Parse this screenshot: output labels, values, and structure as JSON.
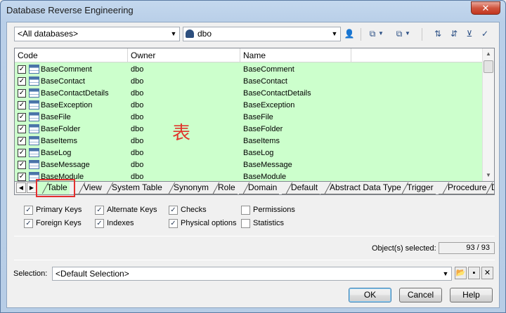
{
  "window": {
    "title": "Database Reverse Engineering",
    "close_label": "✕"
  },
  "toolbar": {
    "database_combo": "<All databases>",
    "owner_combo": "dbo"
  },
  "grid": {
    "columns": [
      "Code",
      "Owner",
      "Name"
    ],
    "rows": [
      {
        "code": "BaseComment",
        "owner": "dbo",
        "name": "BaseComment"
      },
      {
        "code": "BaseContact",
        "owner": "dbo",
        "name": "BaseContact"
      },
      {
        "code": "BaseContactDetails",
        "owner": "dbo",
        "name": "BaseContactDetails"
      },
      {
        "code": "BaseException",
        "owner": "dbo",
        "name": "BaseException"
      },
      {
        "code": "BaseFile",
        "owner": "dbo",
        "name": "BaseFile"
      },
      {
        "code": "BaseFolder",
        "owner": "dbo",
        "name": "BaseFolder"
      },
      {
        "code": "BaseItems",
        "owner": "dbo",
        "name": "BaseItems"
      },
      {
        "code": "BaseLog",
        "owner": "dbo",
        "name": "BaseLog"
      },
      {
        "code": "BaseMessage",
        "owner": "dbo",
        "name": "BaseMessage"
      },
      {
        "code": "BaseModule",
        "owner": "dbo",
        "name": "BaseModule"
      }
    ],
    "annotation": "表"
  },
  "tabs": [
    "Table",
    "View",
    "System Table",
    "Synonym",
    "Role",
    "Domain",
    "Default",
    "Abstract Data Type",
    "Trigger",
    "Procedure",
    "D"
  ],
  "active_tab": "Table",
  "options": [
    {
      "label": "Primary Keys",
      "checked": true
    },
    {
      "label": "Alternate Keys",
      "checked": true
    },
    {
      "label": "Checks",
      "checked": true
    },
    {
      "label": "Permissions",
      "checked": false
    },
    {
      "label": "Foreign Keys",
      "checked": true
    },
    {
      "label": "Indexes",
      "checked": true
    },
    {
      "label": "Physical options",
      "checked": true
    },
    {
      "label": "Statistics",
      "checked": false
    }
  ],
  "status": {
    "selected_label": "Object(s) selected:",
    "selected_value": "93 / 93"
  },
  "selection": {
    "label": "Selection:",
    "value": "<Default Selection>"
  },
  "buttons": {
    "ok": "OK",
    "cancel": "Cancel",
    "help": "Help"
  }
}
